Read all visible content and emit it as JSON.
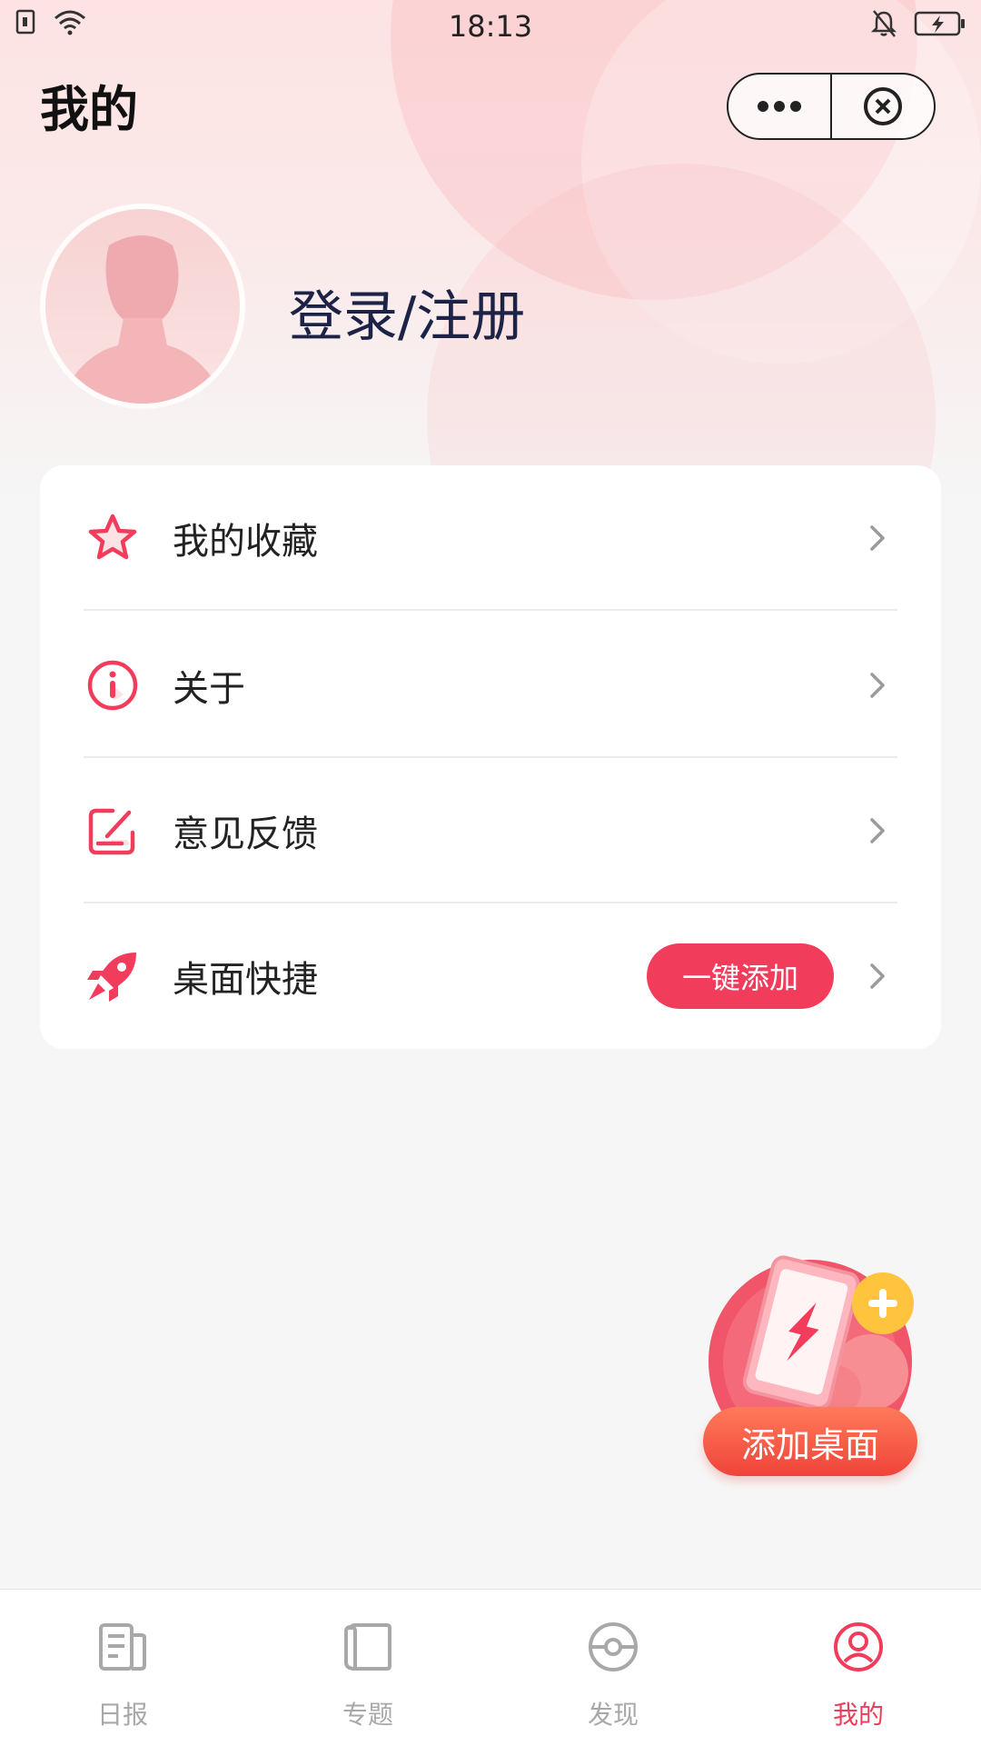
{
  "status_bar": {
    "time": "18:13"
  },
  "header": {
    "title": "我的"
  },
  "profile": {
    "login_label": "登录/注册"
  },
  "menu": {
    "items": [
      {
        "label": "我的收藏",
        "icon": "star-icon"
      },
      {
        "label": "关于",
        "icon": "info-icon"
      },
      {
        "label": "意见反馈",
        "icon": "feedback-edit-icon"
      },
      {
        "label": "桌面快捷",
        "icon": "rocket-icon",
        "action_label": "一键添加"
      }
    ]
  },
  "float_widget": {
    "label": "添加桌面"
  },
  "tabs": [
    {
      "label": "日报",
      "icon": "newspaper-icon",
      "active": false
    },
    {
      "label": "专题",
      "icon": "book-icon",
      "active": false
    },
    {
      "label": "发现",
      "icon": "compass-icon",
      "active": false
    },
    {
      "label": "我的",
      "icon": "user-circle-icon",
      "active": true
    }
  ],
  "colors": {
    "accent": "#f23c5c",
    "title_text": "#1d2346",
    "inactive_tab": "#a8a8a8"
  }
}
